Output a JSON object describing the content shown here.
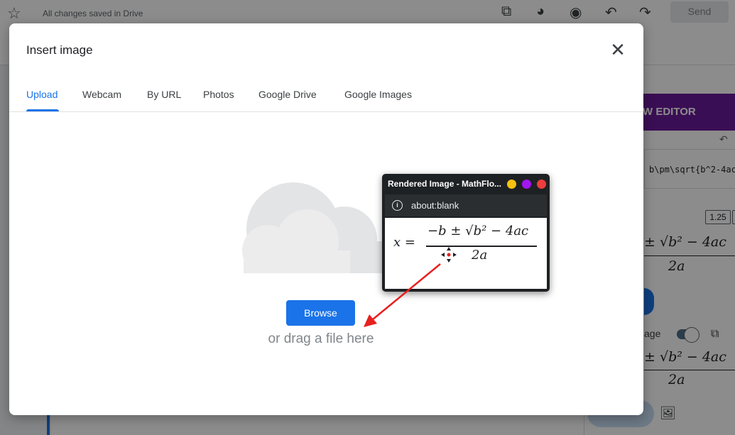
{
  "app": {
    "saved_status": "All changes saved in Drive",
    "send_label": "Send"
  },
  "toolbar_icons": [
    "star-icon",
    "puzzle-icon",
    "palette-icon",
    "eye-icon",
    "undo-icon",
    "redo-icon"
  ],
  "side_panel": {
    "header_label": "W EDITOR",
    "latex_snippet": "b\\pm\\sqrt{b^2-4ac",
    "scale_value": "1.25",
    "preview_top": "± √b² − 4ac",
    "preview_bottom": "2a",
    "toggle_label": "age",
    "preview2_top": "± √b² − 4ac",
    "preview2_bottom": "2a"
  },
  "dialog": {
    "title": "Insert image",
    "tabs": [
      {
        "label": "Upload",
        "active": true
      },
      {
        "label": "Webcam",
        "active": false
      },
      {
        "label": "By URL",
        "active": false
      },
      {
        "label": "Photos",
        "active": false
      },
      {
        "label": "Google Drive",
        "active": false
      },
      {
        "label": "Google Images",
        "active": false
      }
    ],
    "browse_label": "Browse",
    "drag_text": "or drag a file here"
  },
  "floating_window": {
    "title": "Rendered Image - MathFlo...",
    "url_label": "about:blank",
    "dot_colors": [
      "#f5c211",
      "#a416f0",
      "#ee3d3d"
    ],
    "equation": {
      "lhs": "x =",
      "numerator": "−b ± √b² − 4ac",
      "denominator": "2a"
    }
  },
  "colors": {
    "accent": "#1a73e8",
    "panel_header": "#6a1b9a",
    "arrow": "#e8201f"
  }
}
